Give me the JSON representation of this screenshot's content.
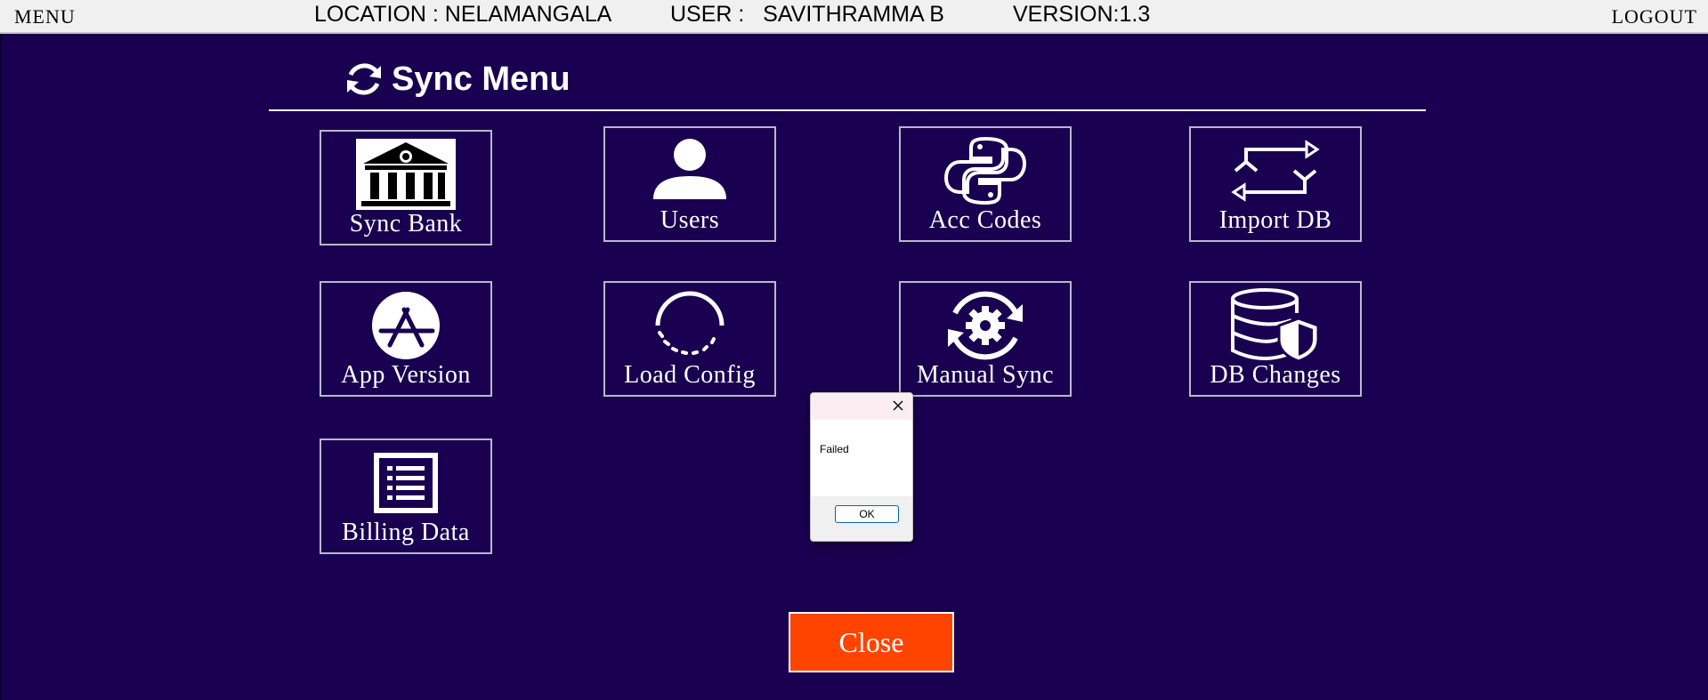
{
  "topbar": {
    "menu_label": "MENU",
    "location": "LOCATION : NELAMANGALA",
    "user": "USER :   SAVITHRAMMA B",
    "version": "VERSION:1.3",
    "logout_label": "LOGOUT"
  },
  "page": {
    "title": "Sync Menu",
    "title_icon": "sync-icon"
  },
  "tiles": [
    {
      "label": "Sync Bank",
      "icon": "bank-icon"
    },
    {
      "label": "Users",
      "icon": "user-icon"
    },
    {
      "label": "Acc Codes",
      "icon": "python-icon"
    },
    {
      "label": "Import DB",
      "icon": "repeat-icon"
    },
    {
      "label": "App Version",
      "icon": "app-store-icon"
    },
    {
      "label": "Load Config",
      "icon": "loading-icon"
    },
    {
      "label": "Manual Sync",
      "icon": "gear-sync-icon"
    },
    {
      "label": "DB Changes",
      "icon": "database-shield-icon"
    },
    {
      "label": "Billing Data",
      "icon": "list-document-icon"
    }
  ],
  "dialog": {
    "message": "Failed",
    "ok_label": "OK"
  },
  "close_label": "Close",
  "colors": {
    "background": "#1a0050",
    "close_button": "#ff4400",
    "topbar": "#f0f0f0"
  }
}
